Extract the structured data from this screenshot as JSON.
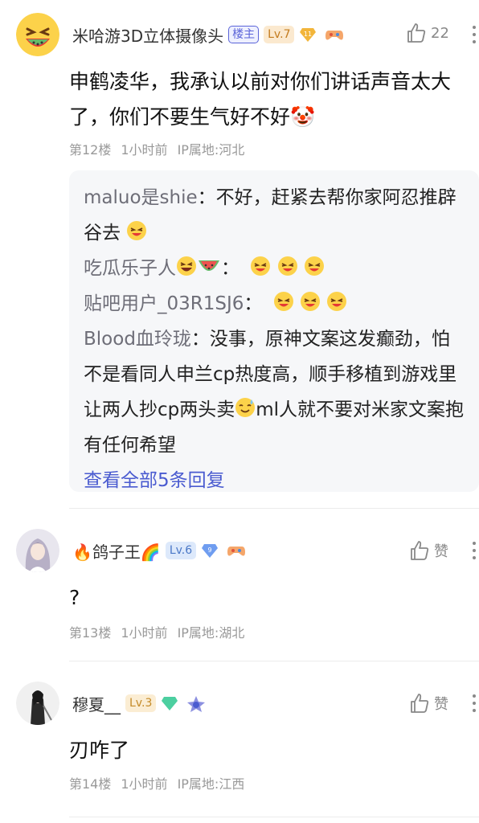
{
  "posts": [
    {
      "author": "米哈游3D立体摄像头",
      "host_badge": "楼主",
      "level": "Lv.7",
      "level_icon_text": "11",
      "likes": "22",
      "content": "申鹤凌华，我承认以前对你们讲话声音太大了，你们不要生气好不好🤡",
      "floor": "第12楼",
      "time": "1小时前",
      "ip": "IP属地:河北"
    },
    {
      "author": "🔥鸽子王🌈",
      "level": "Lv.6",
      "level_icon_text": "9",
      "likes": "赞",
      "content": "?",
      "floor": "第13楼",
      "time": "1小时前",
      "ip": "IP属地:湖北"
    },
    {
      "author": "穆夏__",
      "level": "Lv.3",
      "likes": "赞",
      "content": "刃咋了",
      "floor": "第14楼",
      "time": "1小时前",
      "ip": "IP属地:江西"
    }
  ],
  "replies": [
    {
      "name": "maluo是shie",
      "sep": "：",
      "text": "不好，赶紧去帮你家阿忍推辟谷去"
    },
    {
      "name": "吃瓜乐子人",
      "sep": "：",
      "text": ""
    },
    {
      "name": "贴吧用户_03R1SJ6",
      "sep": "：",
      "text": ""
    },
    {
      "name": "Blood血玲珑",
      "sep": "：",
      "text": "没事，原神文案这发癫劲，怕不是看同人申兰cp热度高，顺手移植到游戏里让两人抄cp两头卖",
      "text2": "ml人就不要对米家文案抱有任何希望"
    }
  ],
  "view_all": "查看全部5条回复",
  "colors": {
    "accent": "#4a5bd0",
    "meta": "#999999",
    "reply_bg": "#f6f7f9"
  }
}
